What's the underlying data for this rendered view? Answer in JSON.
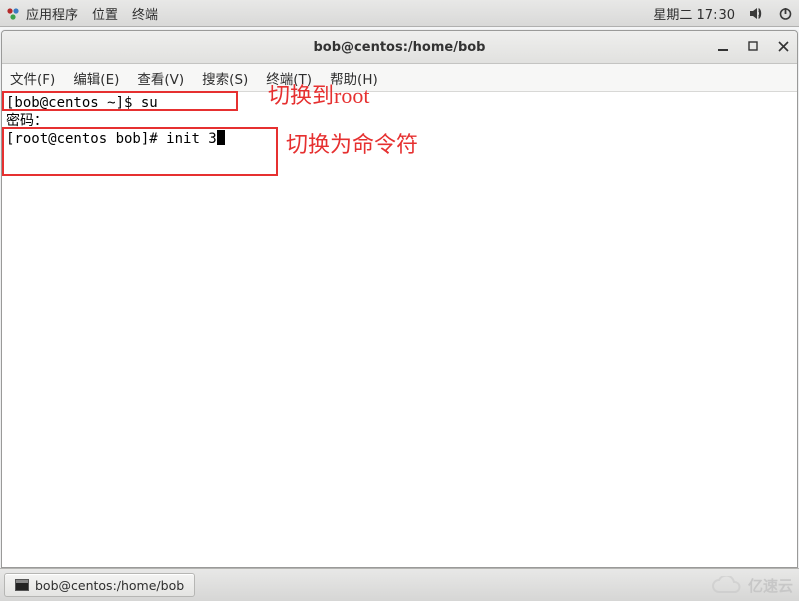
{
  "panel": {
    "apps": "应用程序",
    "places": "位置",
    "terminal": "终端",
    "clock_day": "星期二",
    "clock_time_h": "17",
    "clock_time_m": "30"
  },
  "window": {
    "title": "bob@centos:/home/bob",
    "menus": {
      "file": "文件(F)",
      "edit": "编辑(E)",
      "view": "查看(V)",
      "search": "搜索(S)",
      "terminal": "终端(T)",
      "help": "帮助(H)"
    }
  },
  "terminal": {
    "line1_prompt": "[bob@centos ~]$ ",
    "line1_cmd": "su",
    "line2": "密码：",
    "line3_prompt": "[root@centos bob]# ",
    "line3_cmd": "init 3"
  },
  "annotations": {
    "a1": "切换到root",
    "a2": "切换为命令符"
  },
  "taskbar": {
    "task": "bob@centos:/home/bob"
  },
  "watermark": "亿速云"
}
